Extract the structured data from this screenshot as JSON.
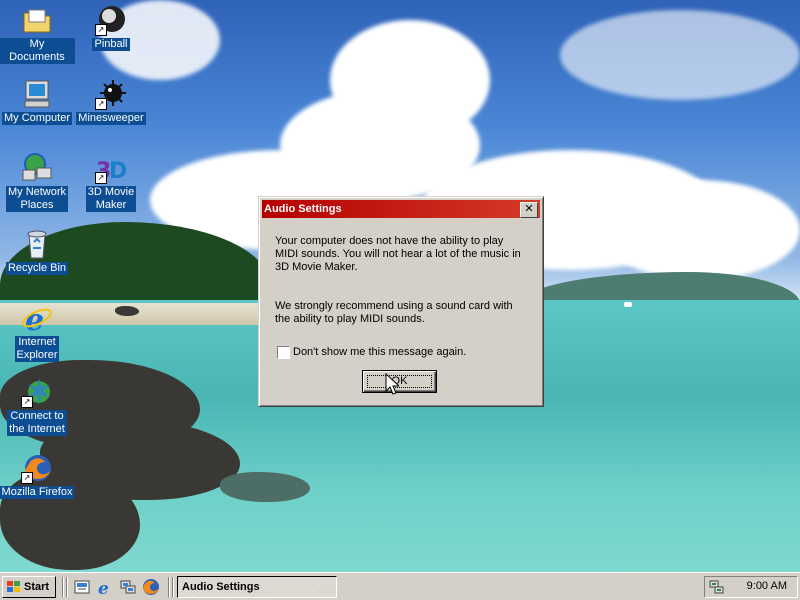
{
  "desktop": {
    "icons": [
      {
        "label": "My Documents",
        "icon": "folder-documents-icon"
      },
      {
        "label": "Pinball",
        "icon": "pinball-icon"
      },
      {
        "label": "My Computer",
        "icon": "computer-icon"
      },
      {
        "label": "Minesweeper",
        "icon": "minesweeper-icon"
      },
      {
        "label_lines": [
          "My Network",
          "Places"
        ],
        "icon": "network-places-icon"
      },
      {
        "label_lines": [
          "3D Movie",
          "Maker"
        ],
        "icon": "3d-movie-maker-icon"
      },
      {
        "label": "Recycle Bin",
        "icon": "recycle-bin-icon"
      },
      {
        "label_lines": [
          "Internet",
          "Explorer"
        ],
        "icon": "internet-explorer-icon"
      },
      {
        "label_lines": [
          "Connect to",
          "the Internet"
        ],
        "icon": "connect-internet-icon"
      },
      {
        "label": "Mozilla Firefox",
        "icon": "firefox-icon"
      }
    ]
  },
  "dialog": {
    "title": "Audio Settings",
    "close_glyph": "✕",
    "message1": "Your computer does not have the ability to play MIDI sounds.  You will not hear a lot of the music in 3D Movie Maker.",
    "message2": "We strongly recommend using a sound card with the ability to play MIDI sounds.",
    "checkbox_label": "Don't show me this message again.",
    "checkbox_checked": false,
    "ok_label": "OK"
  },
  "taskbar": {
    "start_label": "Start",
    "quick_launch": [
      "show-desktop-icon",
      "internet-explorer-icon",
      "network-icon",
      "firefox-icon"
    ],
    "active_task": "Audio Settings",
    "clock": "9:00 AM",
    "tray_icon": "network-tray-icon"
  },
  "colors": {
    "titlebar": "#b50000",
    "face": "#d4d0c8",
    "icon_label_bg": "#0c4d93"
  }
}
